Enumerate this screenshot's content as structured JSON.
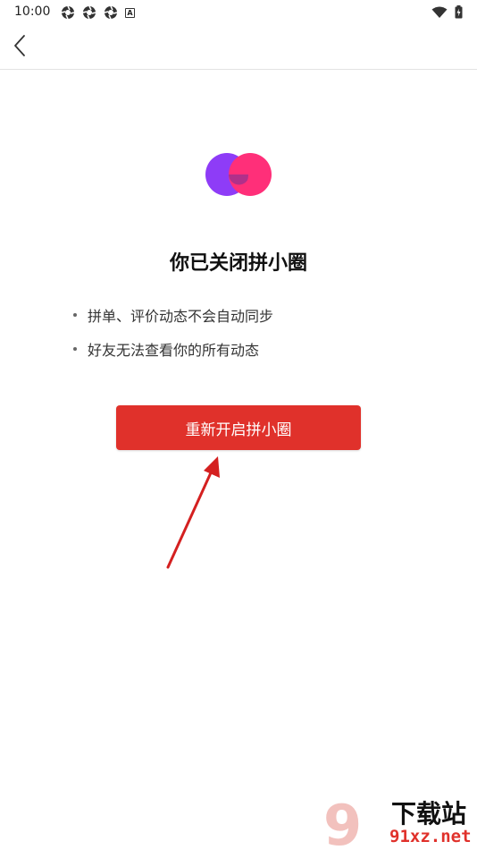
{
  "status_bar": {
    "time": "10:00",
    "left_icons": [
      "aperture-icon",
      "aperture-icon",
      "aperture-icon",
      "letter-a-icon"
    ],
    "letter_a": "A",
    "right_icons": [
      "wifi-icon",
      "battery-charging-icon"
    ]
  },
  "nav": {
    "back_icon": "chevron-left-icon"
  },
  "logo": {
    "icon": "overlapping-circles-icon",
    "colors": [
      "#8e3cf7",
      "#ff2f79",
      "#b0308a"
    ]
  },
  "main": {
    "title": "你已关闭拼小圈",
    "bullets": [
      "拼单、评价动态不会自动同步",
      "好友无法查看你的所有动态"
    ],
    "button_label": "重新开启拼小圈",
    "button_color": "#e0312b"
  },
  "annotation": {
    "icon": "red-arrow-icon",
    "color": "#d42020"
  },
  "watermark": {
    "line1": "下载站",
    "line2": "91xz.net",
    "mark": "9"
  }
}
